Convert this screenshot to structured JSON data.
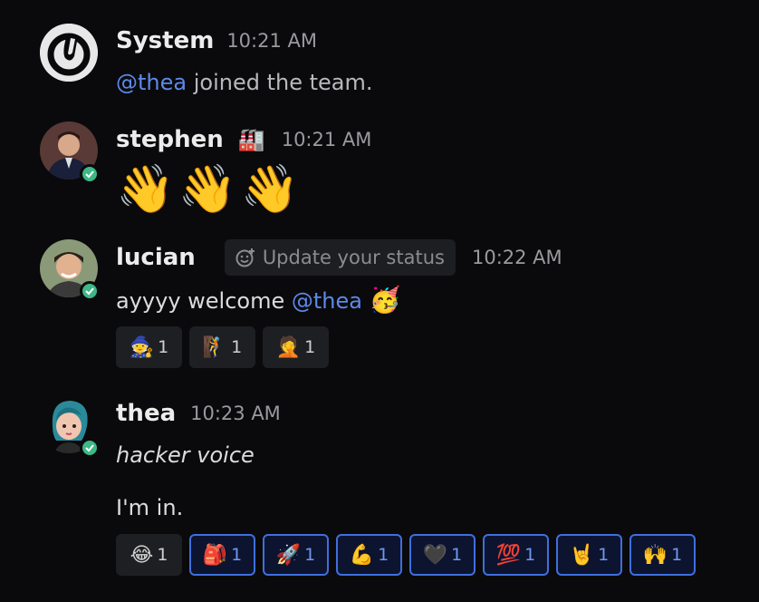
{
  "posts": {
    "system": {
      "username": "System",
      "time": "10:21 AM",
      "mention": "@thea",
      "text": " joined the team."
    },
    "stephen": {
      "username": "stephen",
      "badge_emoji": "🏭",
      "time": "10:21 AM",
      "message": "👋👋👋"
    },
    "lucian": {
      "username": "lucian",
      "status_label": "Update your status",
      "time": "10:22 AM",
      "text": "ayyyy welcome ",
      "mention": "@thea",
      "emoji": "🥳",
      "reactions": [
        {
          "emoji": "🧙",
          "count": "1"
        },
        {
          "emoji": "🧗",
          "count": "1"
        },
        {
          "emoji": "🤦",
          "count": "1"
        }
      ]
    },
    "thea": {
      "username": "thea",
      "time": "10:23 AM",
      "line1": "hacker voice",
      "line2": "I'm in.",
      "reactions": [
        {
          "emoji": "😂",
          "count": "1",
          "active": false
        },
        {
          "emoji": "🎒",
          "count": "1",
          "active": true
        },
        {
          "emoji": "🚀",
          "count": "1",
          "active": true
        },
        {
          "emoji": "💪",
          "count": "1",
          "active": true
        },
        {
          "emoji": "🖤",
          "count": "1",
          "active": true
        },
        {
          "emoji": "💯",
          "count": "1",
          "active": true
        },
        {
          "emoji": "🤘",
          "count": "1",
          "active": true
        },
        {
          "emoji": "🙌",
          "count": "1",
          "active": true
        }
      ]
    }
  },
  "colors": {
    "background": "#0a0a0c",
    "mention": "#5d89ea",
    "online": "#3db887",
    "active_reaction_border": "#3f6fde"
  }
}
